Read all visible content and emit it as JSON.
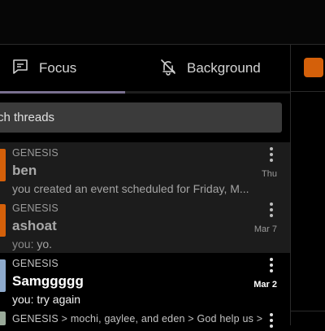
{
  "tabs": [
    {
      "label": "Focus",
      "icon": "message-square-icon",
      "active": true
    },
    {
      "label": "Background",
      "icon": "bell-off-icon",
      "active": false
    }
  ],
  "search": {
    "value": "ch threads"
  },
  "threads": [
    {
      "guild": "GENESIS",
      "name": "ben",
      "preview": "you created an event scheduled for Friday, M...",
      "date": "Thu",
      "bar_color": "#d4600a",
      "unread": false
    },
    {
      "guild": "GENESIS",
      "name": "ashoat",
      "preview_prefix": "you:",
      "preview": "yo.",
      "date": "Mar 7",
      "bar_color": "#d4600a",
      "unread": false
    },
    {
      "guild": "GENESIS",
      "name": "Samggggg",
      "preview_prefix": "you:",
      "preview": "try again",
      "date": "Mar 2",
      "bar_color": "#8eaacc",
      "unread": true
    },
    {
      "guild": "GENESIS > mochi, gaylee, and eden > God help us > \\",
      "bar_color": "#9aaa9a",
      "unread": true
    }
  ],
  "colors": {
    "accent_orange": "#d4600a",
    "tab_indicator": "#7a7090"
  }
}
